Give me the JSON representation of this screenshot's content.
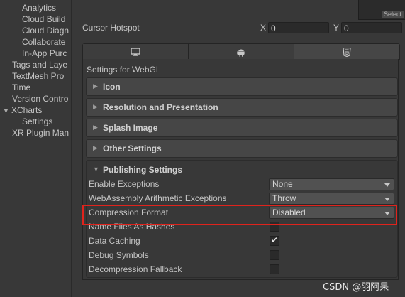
{
  "sidebar": {
    "items": [
      {
        "label": "Analytics"
      },
      {
        "label": "Cloud Build"
      },
      {
        "label": "Cloud Diagn"
      },
      {
        "label": "Collaborate"
      },
      {
        "label": "In-App Purc"
      },
      {
        "label": "Tags and Laye"
      },
      {
        "label": "TextMesh Pro"
      },
      {
        "label": "Time"
      },
      {
        "label": "Version Contro"
      },
      {
        "label": "XCharts"
      },
      {
        "label": "Settings"
      },
      {
        "label": "XR Plugin Man"
      }
    ]
  },
  "header": {
    "select_label": "Select",
    "cursor_hotspot_label": "Cursor Hotspot",
    "x_label": "X",
    "x_value": "0",
    "y_label": "Y",
    "y_value": "0"
  },
  "platform_tabs": [
    {
      "icon": "monitor-icon"
    },
    {
      "icon": "android-icon"
    },
    {
      "icon": "html5-icon"
    }
  ],
  "settings_title": "Settings for WebGL",
  "sections": [
    {
      "title": "Icon"
    },
    {
      "title": "Resolution and Presentation"
    },
    {
      "title": "Splash Image"
    },
    {
      "title": "Other Settings"
    }
  ],
  "publishing": {
    "title": "Publishing Settings",
    "enable_exceptions": {
      "label": "Enable Exceptions",
      "value": "None"
    },
    "wasm_arith_exceptions": {
      "label": "WebAssembly Arithmetic Exceptions",
      "value": "Throw"
    },
    "compression_format": {
      "label": "Compression Format",
      "value": "Disabled"
    },
    "name_files_as_hashes": {
      "label": "Name Files As Hashes",
      "checked": false
    },
    "data_caching": {
      "label": "Data Caching",
      "checked": true
    },
    "debug_symbols": {
      "label": "Debug Symbols",
      "checked": false
    },
    "decompression_fallback": {
      "label": "Decompression Fallback",
      "checked": false
    }
  },
  "watermark": "CSDN @羽阿呆",
  "colors": {
    "highlight": "#e0231c",
    "background": "#383838",
    "foldout": "#464646"
  }
}
